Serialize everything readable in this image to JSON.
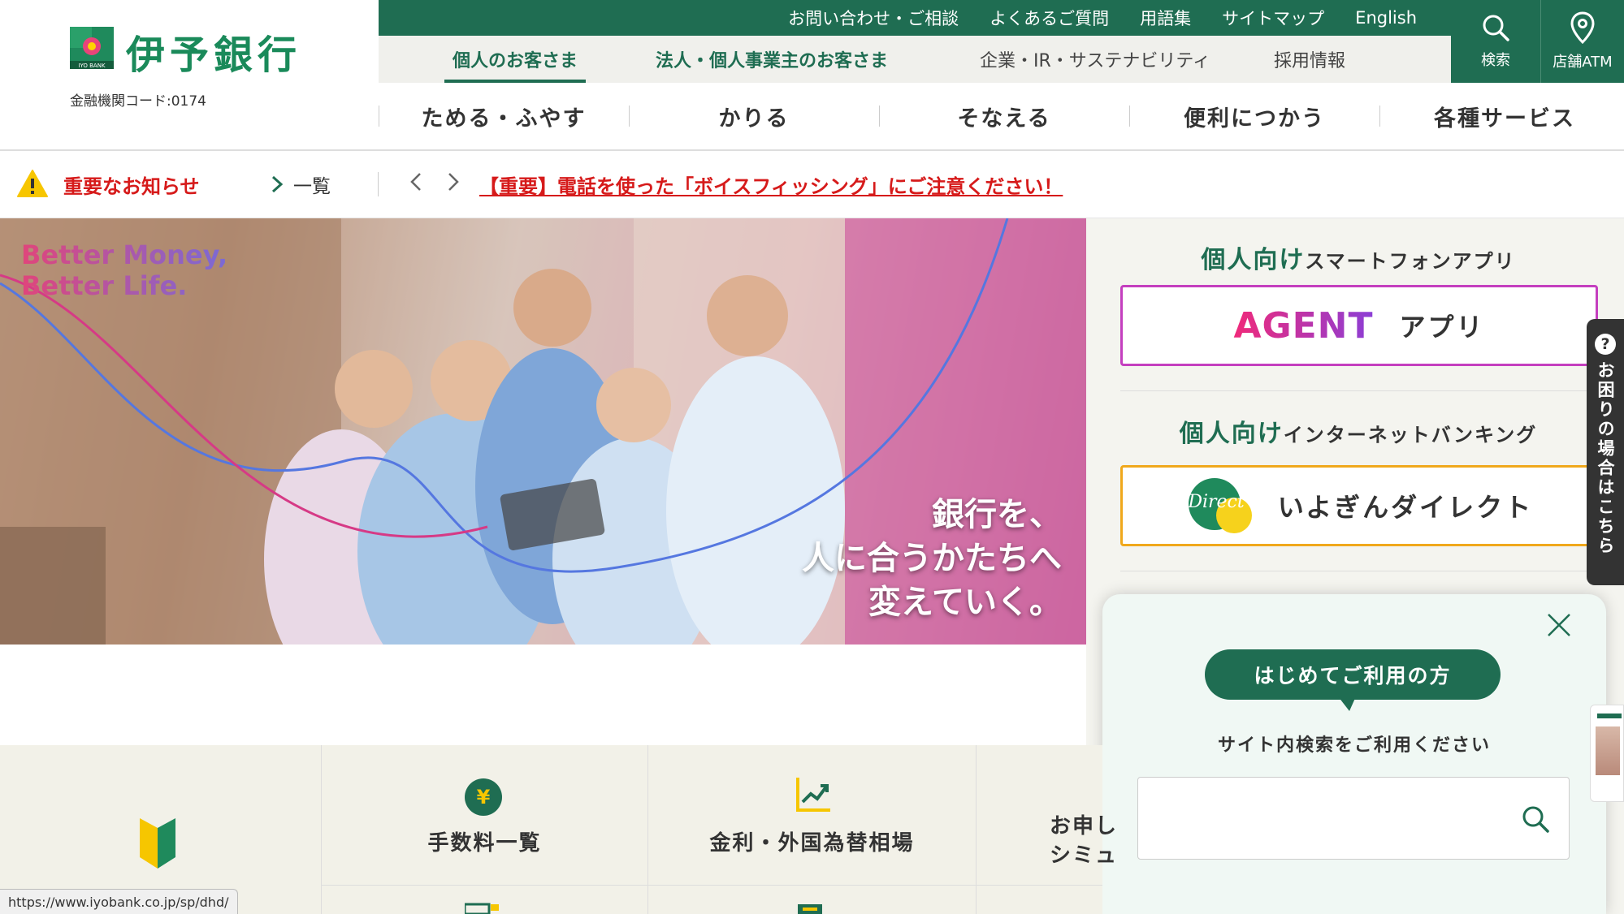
{
  "brand": {
    "name": "伊予銀行",
    "sub": "IYO BANK",
    "bank_code": "金融機関コード:0174"
  },
  "util_links": [
    "お問い合わせ・ご相談",
    "よくあるご質問",
    "用語集",
    "サイトマップ",
    "English"
  ],
  "segment_tabs": [
    "個人のお客さま",
    "法人・個人事業主のお客さま",
    "企業・IR・サステナビリティ",
    "採用情報"
  ],
  "icons": {
    "search_label": "検索",
    "atm_label": "店舗ATM"
  },
  "main_nav": [
    "ためる・ふやす",
    "かりる",
    "そなえる",
    "便利につかう",
    "各種サービス"
  ],
  "notice": {
    "title": "重要なお知らせ",
    "list_label": "一覧",
    "headline": "【重要】電話を使った「ボイスフィッシング」にご注意ください！"
  },
  "hero": {
    "brand_line1": "Better Money,",
    "brand_line2": "Better Life.",
    "copy_line1": "銀行を、",
    "copy_line2": "人に合うかたちへ",
    "copy_line3": "変えていく。"
  },
  "apps": {
    "smartphone_heading_green": "個人向け",
    "smartphone_heading_rest": "スマートフォンアプリ",
    "agent_logo": "AGENT",
    "agent_label": "アプリ",
    "ib_heading_green": "個人向け",
    "ib_heading_rest": "インターネットバンキング",
    "direct_logo": "Direct",
    "direct_label": "いよぎんダイレクト"
  },
  "search_card": {
    "badge": "はじめてご利用の方",
    "hint": "サイト内検索をご利用ください",
    "input_value": ""
  },
  "help_tab": {
    "label": "お困りの場合はこちら"
  },
  "quick_links": [
    "手数料一覧",
    "金利・外国為替相場",
    "お申し",
    "シミュ"
  ],
  "status_url": "https://www.iyobank.co.jp/sp/dhd/",
  "colors": {
    "brand_green": "#1f6d52",
    "alert_red": "#d61a1a",
    "agent_border": "#c43fbf",
    "direct_border": "#f0a81c"
  }
}
